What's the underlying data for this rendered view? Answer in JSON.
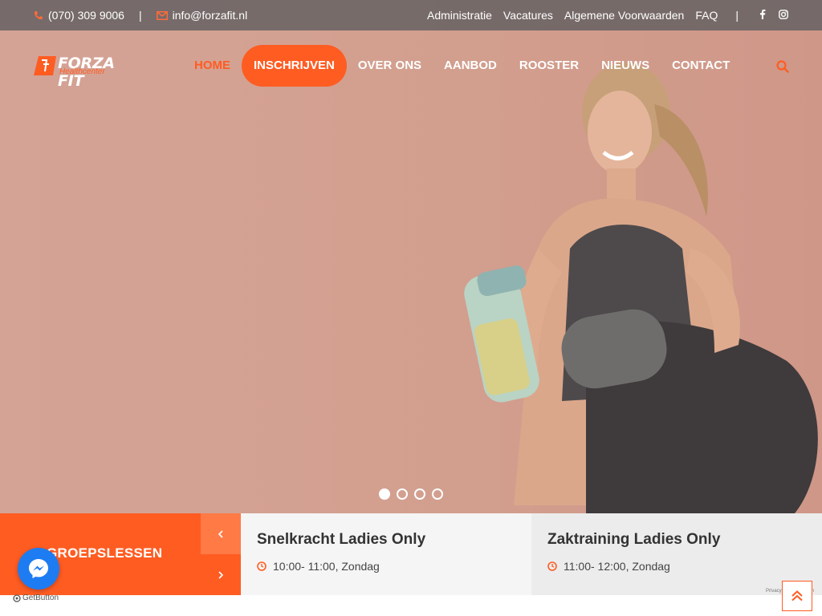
{
  "topbar": {
    "phone": "(070) 309 9006",
    "email": "info@forzafit.nl",
    "links": [
      "Administratie",
      "Vacatures",
      "Algemene Voorwaarden",
      "FAQ"
    ],
    "divider": "|"
  },
  "brand": {
    "name": "FORZA FIT",
    "tagline": "Healthcenter"
  },
  "nav": {
    "items": [
      {
        "label": "HOME"
      },
      {
        "label": "INSCHRIJVEN"
      },
      {
        "label": "OVER ONS"
      },
      {
        "label": "AANBOD"
      },
      {
        "label": "ROOSTER"
      },
      {
        "label": "NIEUWS"
      },
      {
        "label": "CONTACT"
      }
    ],
    "active_index": 0,
    "highlight_index": 1
  },
  "slider": {
    "slide_count": 4,
    "active_slide": 1
  },
  "group_classes": {
    "label": "GROEPSLESSEN",
    "cards": [
      {
        "title": "Snelkracht Ladies Only",
        "time": "10:00- 11:00, Zondag"
      },
      {
        "title": "Zaktraining Ladies Only",
        "time": "11:00- 12:00, Zondag"
      }
    ]
  },
  "widgets": {
    "getbutton_label": "GetButton",
    "recaptcha_text": "Privacy - Voorwaarden"
  },
  "colors": {
    "accent": "#ff5c22",
    "topbar": "#6e6666",
    "messenger": "#1d7cf2",
    "hero_bg": "#d8a493"
  }
}
